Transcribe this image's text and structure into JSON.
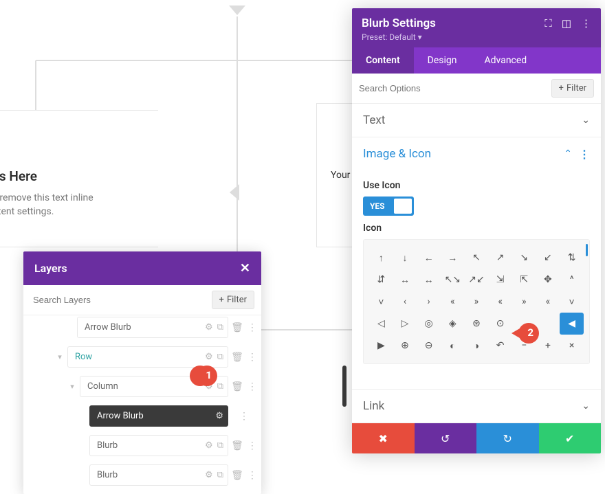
{
  "bg": {
    "blurb_left": {
      "title": "r Title Goes Here",
      "body_line1": "s here. Edit or remove this text inline",
      "body_line2": "e module Content settings."
    },
    "blurb_right_partial": "Your"
  },
  "layers": {
    "title": "Layers",
    "search_placeholder": "Search Layers",
    "filter_label": "Filter",
    "rows": [
      {
        "label": "Arrow Blurb",
        "type": "module"
      },
      {
        "label": "Row",
        "type": "row"
      },
      {
        "label": "Column",
        "type": "column"
      },
      {
        "label": "Arrow Blurb",
        "type": "module",
        "active": true
      },
      {
        "label": "Blurb",
        "type": "module"
      },
      {
        "label": "Blurb",
        "type": "module"
      }
    ]
  },
  "callouts": {
    "one": "1",
    "two": "2"
  },
  "settings": {
    "title": "Blurb Settings",
    "preset": "Preset: Default",
    "tabs": {
      "content": "Content",
      "design": "Design",
      "advanced": "Advanced"
    },
    "search_placeholder": "Search Options",
    "filter_label": "Filter",
    "sections": {
      "text": "Text",
      "image_icon": "Image & Icon",
      "link": "Link"
    },
    "use_icon_label": "Use Icon",
    "use_icon_value": "YES",
    "icon_label": "Icon",
    "icon_rows": [
      [
        "↑",
        "↓",
        "←",
        "→",
        "↖",
        "↗",
        "↘",
        "↙",
        "⇅"
      ],
      [
        "⇵",
        "↔",
        "↔",
        "↖↘",
        "↗↙",
        "⇲",
        "⇱",
        "✥",
        "^"
      ],
      [
        "˅",
        "‹",
        "›",
        "«",
        "»",
        "«",
        "»",
        "«",
        "˅"
      ],
      [
        "◁",
        "▷",
        "◎",
        "◈",
        "⊛",
        "⊙",
        "",
        "",
        "◀"
      ],
      [
        "▶",
        "⊕",
        "⊖",
        "◐",
        "◑",
        "↶",
        "−",
        "+",
        "×"
      ]
    ],
    "selected_icon": {
      "row": 3,
      "col": 8
    }
  }
}
